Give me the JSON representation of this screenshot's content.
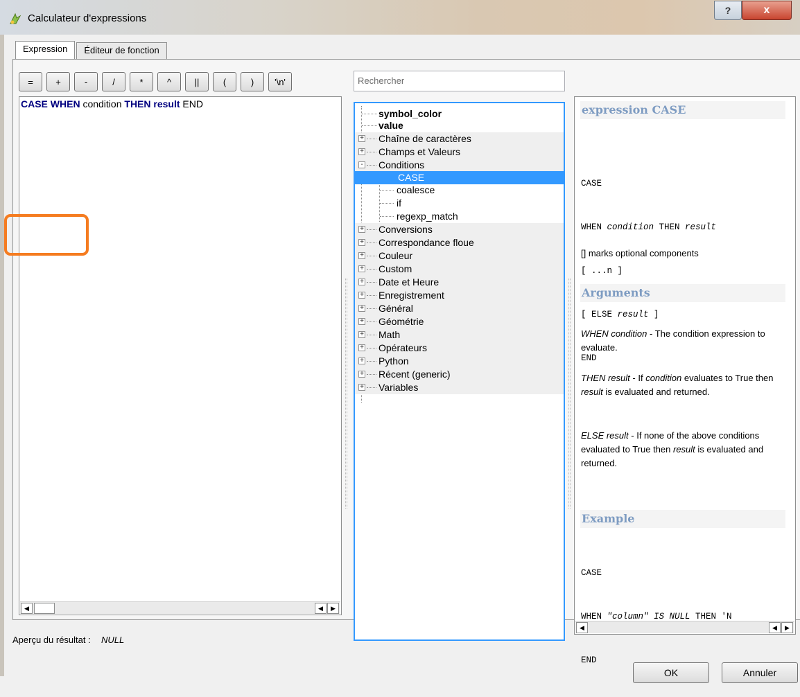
{
  "window": {
    "title": "Calculateur d'expressions",
    "help_glyph": "?",
    "close_glyph": "x"
  },
  "tabs": [
    {
      "label": "Expression",
      "active": true
    },
    {
      "label": "Éditeur de fonction",
      "active": false
    }
  ],
  "operators": [
    "=",
    "+",
    "-",
    "/",
    "*",
    "^",
    "||",
    "(",
    ")",
    "'\\n'"
  ],
  "editor": {
    "tokens": [
      {
        "text": "CASE WHEN",
        "keyword": true
      },
      {
        "text": " condition ",
        "keyword": false
      },
      {
        "text": "THEN result",
        "keyword": true
      },
      {
        "text": " END",
        "keyword": false
      }
    ]
  },
  "search": {
    "placeholder": "Rechercher"
  },
  "tree": {
    "items": [
      {
        "label": "symbol_color",
        "level": 0,
        "bold": true
      },
      {
        "label": "value",
        "level": 0,
        "bold": true
      },
      {
        "label": "Chaîne de caractères",
        "level": 0,
        "expander": "+"
      },
      {
        "label": "Champs et Valeurs",
        "level": 0,
        "expander": "+"
      },
      {
        "label": "Conditions",
        "level": 0,
        "expander": "-"
      },
      {
        "label": "CASE",
        "level": 1,
        "selected": true
      },
      {
        "label": "coalesce",
        "level": 1
      },
      {
        "label": "if",
        "level": 1
      },
      {
        "label": "regexp_match",
        "level": 1
      },
      {
        "label": "Conversions",
        "level": 0,
        "expander": "+"
      },
      {
        "label": "Correspondance floue",
        "level": 0,
        "expander": "+"
      },
      {
        "label": "Couleur",
        "level": 0,
        "expander": "+"
      },
      {
        "label": "Custom",
        "level": 0,
        "expander": "+"
      },
      {
        "label": "Date et Heure",
        "level": 0,
        "expander": "+"
      },
      {
        "label": "Enregistrement",
        "level": 0,
        "expander": "+"
      },
      {
        "label": "Général",
        "level": 0,
        "expander": "+"
      },
      {
        "label": "Géométrie",
        "level": 0,
        "expander": "+"
      },
      {
        "label": "Math",
        "level": 0,
        "expander": "+"
      },
      {
        "label": "Opérateurs",
        "level": 0,
        "expander": "+"
      },
      {
        "label": "Python",
        "level": 0,
        "expander": "+"
      },
      {
        "label": "Récent (generic)",
        "level": 0,
        "expander": "+"
      },
      {
        "label": "Variables",
        "level": 0,
        "expander": "+"
      }
    ]
  },
  "help": {
    "title": "expression CASE",
    "syntax_lines": [
      [
        {
          "t": "CASE"
        }
      ],
      [
        {
          "t": "WHEN "
        },
        {
          "t": "condition",
          "i": true
        },
        {
          "t": " THEN "
        },
        {
          "t": "result",
          "i": true
        }
      ],
      [
        {
          "t": "[ ...n ]"
        }
      ],
      [
        {
          "t": "[ ELSE "
        },
        {
          "t": "result",
          "i": true
        },
        {
          "t": " ]"
        }
      ],
      [
        {
          "t": "END"
        }
      ]
    ],
    "optional_note": "[] marks optional components",
    "arguments_heading": "Arguments",
    "arguments": [
      [
        {
          "t": "WHEN condition",
          "i": true
        },
        {
          "t": " - The condition expression to evaluate."
        }
      ],
      [
        {
          "t": "THEN result",
          "i": true
        },
        {
          "t": " - If "
        },
        {
          "t": "condition",
          "i": true
        },
        {
          "t": " evaluates to True then "
        },
        {
          "t": "result",
          "i": true
        },
        {
          "t": " is evaluated and returned."
        }
      ],
      [
        {
          "t": "ELSE result",
          "i": true
        },
        {
          "t": " - If none of the above conditions evaluated to True then "
        },
        {
          "t": "result",
          "i": true
        },
        {
          "t": " is evaluated and returned."
        }
      ]
    ],
    "example_heading": "Example",
    "example_lines": [
      [
        {
          "t": "CASE"
        }
      ],
      [
        {
          "t": "WHEN "
        },
        {
          "t": "\"column\" IS NULL",
          "i": true
        },
        {
          "t": " THEN 'N"
        }
      ],
      [
        {
          "t": "END"
        }
      ]
    ]
  },
  "preview": {
    "label": "Aperçu du résultat :",
    "value": "NULL"
  },
  "buttons": {
    "ok": "OK",
    "cancel": "Annuler"
  },
  "colors": {
    "keyword": "#000080",
    "selection": "#3399ff",
    "highlight": "#f57c20",
    "help_heading": "#7e9cc2"
  }
}
